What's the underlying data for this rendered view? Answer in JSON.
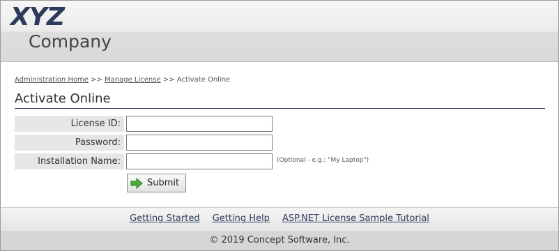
{
  "header": {
    "logo_top": "XYZ",
    "logo_bottom": "Company"
  },
  "breadcrumb": {
    "items": [
      "Administration Home",
      "Manage License",
      "Activate Online"
    ],
    "separator": ">>"
  },
  "page": {
    "title": "Activate Online"
  },
  "form": {
    "license_id": {
      "label": "License ID:",
      "value": ""
    },
    "password": {
      "label": "Password:",
      "value": ""
    },
    "installation_name": {
      "label": "Installation Name:",
      "value": "",
      "hint": "(Optional - e.g.: \"My Laptop\")"
    },
    "submit_label": "Submit",
    "submit_icon": "green-arrow-icon"
  },
  "footer": {
    "links": [
      "Getting Started",
      "Getting Help",
      "ASP.NET License Sample Tutorial"
    ],
    "copyright": "© 2019 Concept Software, Inc."
  },
  "colors": {
    "brand": "#2c3a5c",
    "label_bg": "#e6e6e6",
    "arrow": "#4caf3a"
  }
}
